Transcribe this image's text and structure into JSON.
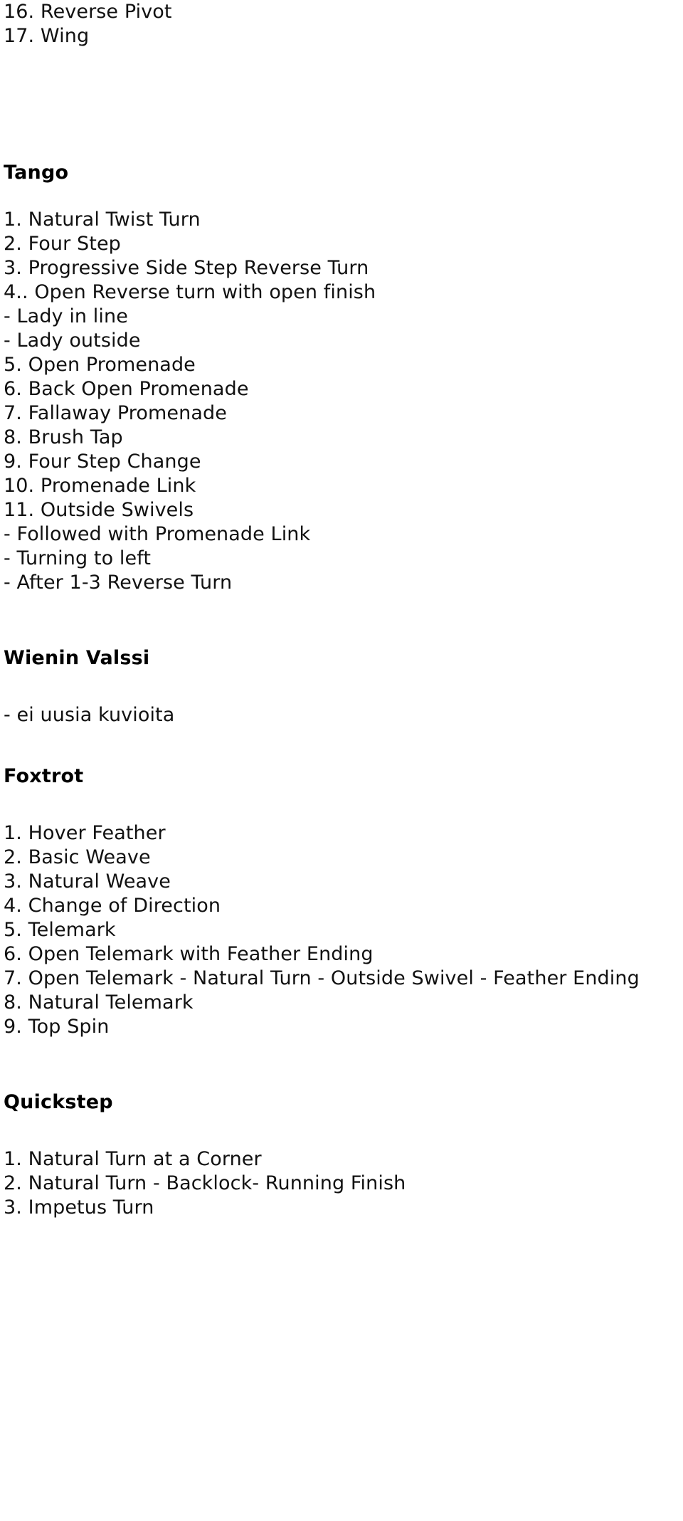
{
  "document": {
    "continued_list_top": [
      "16. Reverse Pivot",
      "17. Wing"
    ],
    "sections": [
      {
        "heading": "Tango",
        "items": [
          "1. Natural Twist Turn",
          "2. Four Step",
          "3. Progressive Side Step Reverse Turn",
          "4.. Open Reverse turn with open finish",
          "- Lady in line",
          "- Lady outside",
          "5. Open Promenade",
          "6. Back Open Promenade",
          "7. Fallaway Promenade",
          "8. Brush Tap",
          "9. Four Step Change",
          "10. Promenade Link",
          "11. Outside Swivels",
          "- Followed with Promenade Link",
          "- Turning to left",
          "- After 1-3 Reverse Turn"
        ]
      },
      {
        "heading": "Wienin Valssi",
        "items": [
          "- ei uusia kuvioita"
        ]
      },
      {
        "heading": "Foxtrot",
        "items": [
          "1. Hover Feather",
          "2. Basic Weave",
          "3. Natural Weave",
          "4. Change of Direction",
          "5. Telemark",
          "6. Open Telemark with Feather Ending",
          "7. Open Telemark - Natural Turn - Outside Swivel - Feather Ending",
          "8. Natural Telemark",
          "9. Top Spin"
        ]
      },
      {
        "heading": "Quickstep",
        "items": [
          "1. Natural Turn at a Corner",
          "2. Natural Turn - Backlock- Running Finish",
          "3. Impetus Turn"
        ]
      }
    ]
  }
}
